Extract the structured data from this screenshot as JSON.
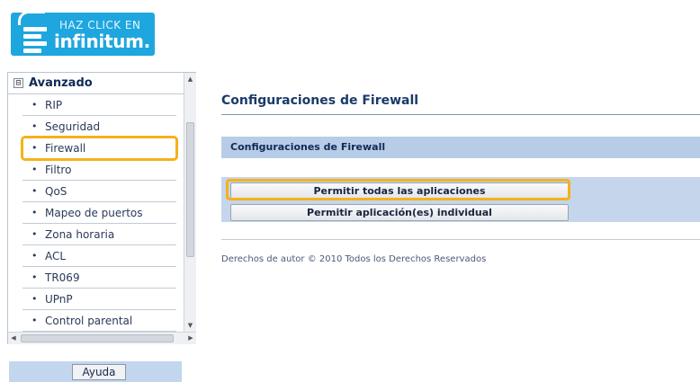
{
  "logo": {
    "line1": "HAZ CLICK EN",
    "line2": "infinitum."
  },
  "nav": {
    "section_title": "Avanzado",
    "toggle_symbol": "⊟",
    "items": [
      {
        "label": "RIP"
      },
      {
        "label": "Seguridad"
      },
      {
        "label": "Firewall",
        "selected": true
      },
      {
        "label": "Filtro"
      },
      {
        "label": "QoS"
      },
      {
        "label": "Mapeo de puertos"
      },
      {
        "label": "Zona horaria"
      },
      {
        "label": "ACL"
      },
      {
        "label": "TR069"
      },
      {
        "label": "UPnP"
      },
      {
        "label": "Control parental"
      }
    ]
  },
  "help": {
    "button_label": "Ayuda"
  },
  "main": {
    "page_title": "Configuraciones de Firewall",
    "section_title": "Configuraciones de Firewall",
    "buttons": {
      "allow_all": "Permitir todas las aplicaciones",
      "allow_individual": "Permitir aplicación(es) individual"
    },
    "copyright": "Derechos de autor © 2010 Todos los Derechos Reservados"
  },
  "colors": {
    "highlight": "#f5b11c",
    "section_header_bg": "#b7cce6",
    "logo_bg": "#1ea6de"
  }
}
